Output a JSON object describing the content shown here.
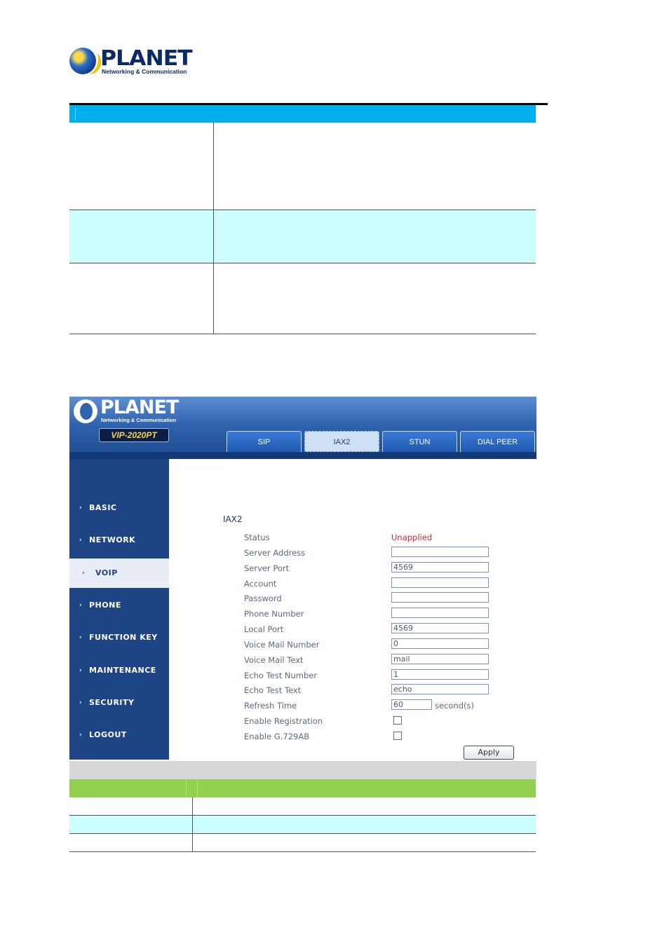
{
  "doc_header": {
    "brand": "PLANET",
    "tagline": "Networking & Communication"
  },
  "app": {
    "brand": "PLANET",
    "tagline": "Networking & Communication",
    "model": "VIP-2020PT",
    "tabs": [
      {
        "label": "SIP",
        "active": false
      },
      {
        "label": "IAX2",
        "active": true
      },
      {
        "label": "STUN",
        "active": false
      },
      {
        "label": "DIAL PEER",
        "active": false
      }
    ],
    "sidebar": {
      "items": [
        {
          "label": "BASIC",
          "active": false
        },
        {
          "label": "NETWORK",
          "active": false
        },
        {
          "label": "VOIP",
          "active": true
        },
        {
          "label": "PHONE",
          "active": false
        },
        {
          "label": "FUNCTION KEY",
          "active": false
        },
        {
          "label": "MAINTENANCE",
          "active": false
        },
        {
          "label": "SECURITY",
          "active": false
        },
        {
          "label": "LOGOUT",
          "active": false
        }
      ]
    },
    "form": {
      "section_title": "IAX2",
      "status_label": "Status",
      "status_value": "Unapplied",
      "server_address_label": "Server Address",
      "server_address_value": "",
      "server_port_label": "Server Port",
      "server_port_value": "4569",
      "account_label": "Account",
      "account_value": "",
      "password_label": "Password",
      "password_value": "",
      "phone_number_label": "Phone Number",
      "phone_number_value": "",
      "local_port_label": "Local Port",
      "local_port_value": "4569",
      "voice_mail_number_label": "Voice Mail Number",
      "voice_mail_number_value": "0",
      "voice_mail_text_label": "Voice Mail Text",
      "voice_mail_text_value": "mail",
      "echo_test_number_label": "Echo Test Number",
      "echo_test_number_value": "1",
      "echo_test_text_label": "Echo Test Text",
      "echo_test_text_value": "echo",
      "refresh_time_label": "Refresh Time",
      "refresh_time_value": "60",
      "refresh_time_unit": "second(s)",
      "enable_registration_label": "Enable Registration",
      "enable_registration_checked": false,
      "enable_g729ab_label": "Enable G.729AB",
      "enable_g729ab_checked": false,
      "apply_label": "Apply"
    }
  },
  "colors": {
    "table_header_blue": "#00b0ee",
    "table_row_cyan": "#ccffff",
    "table_header_green": "#92d050",
    "sidebar_blue": "#1e4485",
    "status_red": "#d4262a"
  }
}
